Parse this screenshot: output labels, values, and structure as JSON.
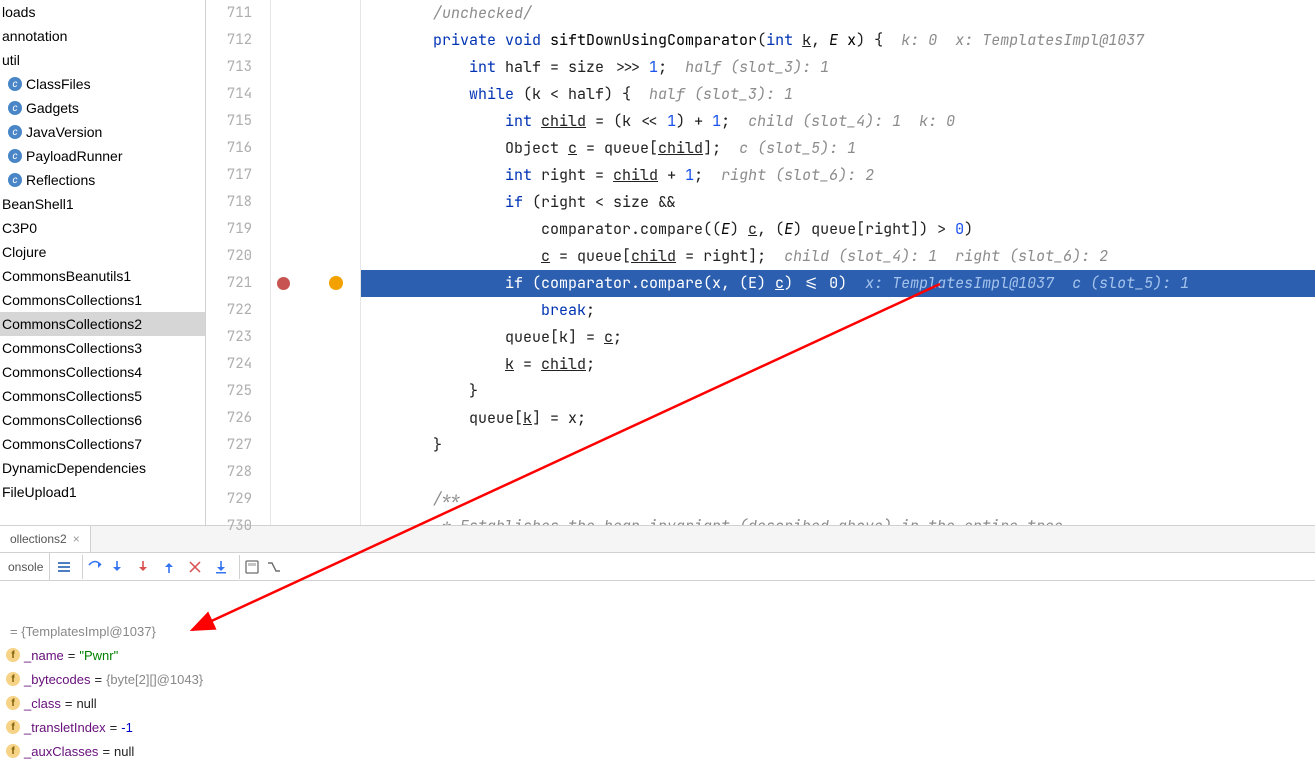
{
  "sidebar": {
    "items": [
      {
        "label": "loads",
        "icon": null
      },
      {
        "label": "annotation",
        "icon": null
      },
      {
        "label": "util",
        "icon": null
      },
      {
        "label": "ClassFiles",
        "icon": "c"
      },
      {
        "label": "Gadgets",
        "icon": "c"
      },
      {
        "label": "JavaVersion",
        "icon": "c"
      },
      {
        "label": "PayloadRunner",
        "icon": "c"
      },
      {
        "label": "Reflections",
        "icon": "c"
      },
      {
        "label": "BeanShell1",
        "icon": null
      },
      {
        "label": "C3P0",
        "icon": null
      },
      {
        "label": "Clojure",
        "icon": null
      },
      {
        "label": "CommonsBeanutils1",
        "icon": null
      },
      {
        "label": "CommonsCollections1",
        "icon": null
      },
      {
        "label": "CommonsCollections2",
        "icon": null,
        "selected": true
      },
      {
        "label": "CommonsCollections3",
        "icon": null
      },
      {
        "label": "CommonsCollections4",
        "icon": null
      },
      {
        "label": "CommonsCollections5",
        "icon": null
      },
      {
        "label": "CommonsCollections6",
        "icon": null
      },
      {
        "label": "CommonsCollections7",
        "icon": null
      },
      {
        "label": "DynamicDependencies",
        "icon": null
      },
      {
        "label": "FileUpload1",
        "icon": null
      }
    ]
  },
  "editor": {
    "first_line": 711,
    "highlight_line": 721,
    "breakpoint_line": 721,
    "inlay": {
      "712": "k: 0  x: TemplatesImpl@1037",
      "713": "half (slot_3): 1",
      "714": "half (slot_3): 1",
      "715": "child (slot_4): 1  k: 0",
      "716": "c (slot_5): 1",
      "717": "right (slot_6): 2",
      "720": "child (slot_4): 1  right (slot_6): 2",
      "721": "x: TemplatesImpl@1037  c (slot_5): 1"
    },
    "code": {
      "711": "/unchecked/",
      "712": "private void siftDownUsingComparator(int k, E x) {",
      "713": "int half = size >>> 1;",
      "714": "while (k < half) {",
      "715": "int child = (k << 1) + 1;",
      "716": "Object c = queue[child];",
      "717": "int right = child + 1;",
      "718": "if (right < size &&",
      "719": "comparator.compare((E) c, (E) queue[right]) > 0)",
      "720": "c = queue[child = right];",
      "721": "if (comparator.compare(x, (E) c) <= 0)",
      "722": "break;",
      "723": "queue[k] = c;",
      "724": "k = child;",
      "725": "}",
      "726": "queue[k] = x;",
      "727": "}",
      "728": "",
      "729": "/**",
      "730": " * Establishes the heap invariant (described above) in the entire tree,"
    }
  },
  "debug": {
    "tab": "ollections2",
    "toolbar_label": "onsole",
    "root": "= {TemplatesImpl@1037}",
    "fields": [
      {
        "name": "_name",
        "value": "\"Pwnr\"",
        "type": "str"
      },
      {
        "name": "_bytecodes",
        "value": "{byte[2][]@1043}",
        "type": "grey"
      },
      {
        "name": "_class",
        "value": "null",
        "type": "plain"
      },
      {
        "name": "_transletIndex",
        "value": "-1",
        "type": "num"
      },
      {
        "name": "_auxClasses",
        "value": "null",
        "type": "plain"
      }
    ]
  }
}
